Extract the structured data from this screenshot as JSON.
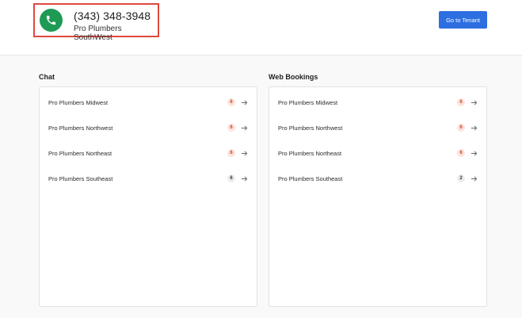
{
  "caller": {
    "phone": "(343) 348-3948",
    "tenant": "Pro Plumbers SouthWest"
  },
  "header": {
    "go_to_tenant_label": "Go to Tenant"
  },
  "colors": {
    "accent_blue": "#2d6fe0",
    "phone_green": "#1e9a54",
    "highlight_red": "#e0483e"
  },
  "chat": {
    "title": "Chat",
    "items": [
      {
        "label": "Pro Plumbers Midwest",
        "count": "6",
        "badge": "red"
      },
      {
        "label": "Pro Plumbers Northwest",
        "count": "6",
        "badge": "red"
      },
      {
        "label": "Pro Plumbers Northeast",
        "count": "6",
        "badge": "red"
      },
      {
        "label": "Pro Plumbers Southeast",
        "count": "6",
        "badge": "gray"
      }
    ]
  },
  "bookings": {
    "title": "Web Bookings",
    "items": [
      {
        "label": "Pro Plumbers Midwest",
        "count": "6",
        "badge": "red"
      },
      {
        "label": "Pro Plumbers Northwest",
        "count": "6",
        "badge": "red"
      },
      {
        "label": "Pro Plumbers Northeast",
        "count": "6",
        "badge": "red"
      },
      {
        "label": "Pro Plumbers Southeast",
        "count": "2",
        "badge": "gray"
      }
    ]
  }
}
